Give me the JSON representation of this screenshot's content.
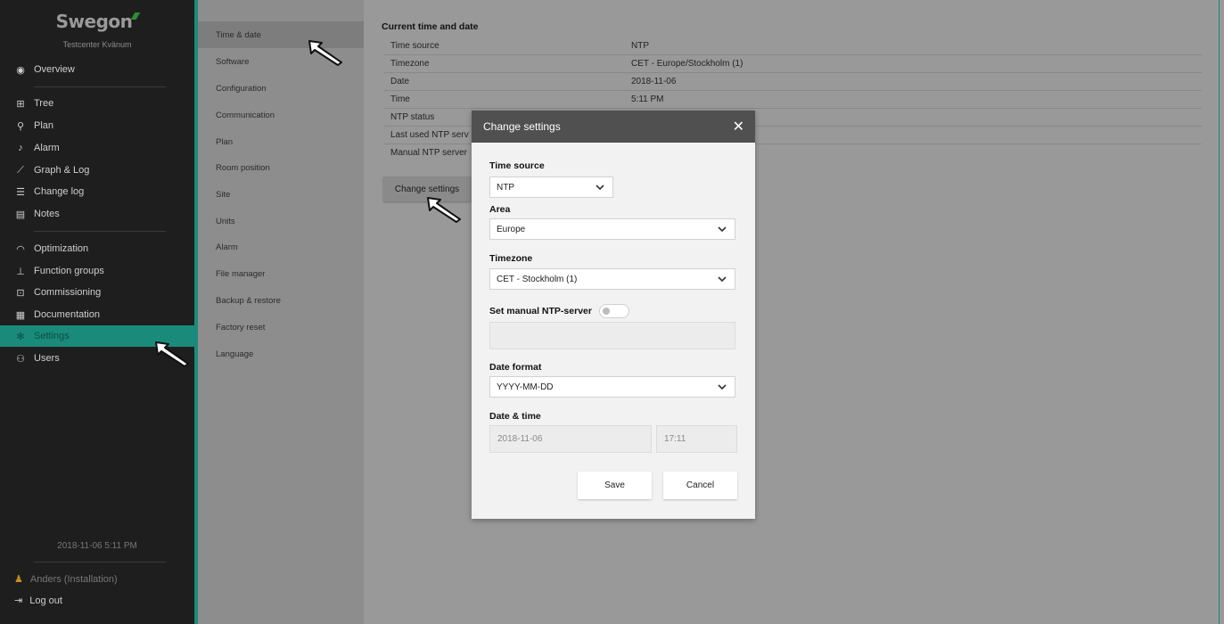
{
  "sidebar": {
    "brand": "Swegon",
    "subtitle": "Testcenter Kvänum",
    "items": [
      {
        "label": "Overview",
        "icon": "eye-icon"
      },
      {
        "label": "Tree",
        "icon": "tree-icon"
      },
      {
        "label": "Plan",
        "icon": "location-pin-icon"
      },
      {
        "label": "Alarm",
        "icon": "bell-icon"
      },
      {
        "label": "Graph & Log",
        "icon": "graph-icon"
      },
      {
        "label": "Change log",
        "icon": "list-icon"
      },
      {
        "label": "Notes",
        "icon": "note-icon"
      },
      {
        "label": "Optimization",
        "icon": "gauge-icon"
      },
      {
        "label": "Function groups",
        "icon": "hierarchy-icon"
      },
      {
        "label": "Commissioning",
        "icon": "commissioning-icon"
      },
      {
        "label": "Documentation",
        "icon": "document-icon"
      },
      {
        "label": "Settings",
        "icon": "gear-icon"
      },
      {
        "label": "Users",
        "icon": "users-icon"
      }
    ],
    "datetime": "2018-11-06 5:11 PM",
    "user": "Anders (Installation)",
    "logout": "Log out"
  },
  "submenu": {
    "items": [
      "Time & date",
      "Software",
      "Configuration",
      "Communication",
      "Plan",
      "Room position",
      "Site",
      "Units",
      "Alarm",
      "File manager",
      "Backup & restore",
      "Factory reset",
      "Language"
    ]
  },
  "main": {
    "section_title": "Current time and date",
    "rows": [
      {
        "key": "Time source",
        "value": "NTP"
      },
      {
        "key": "Timezone",
        "value": "CET - Europe/Stockholm (1)"
      },
      {
        "key": "Date",
        "value": "2018-11-06"
      },
      {
        "key": "Time",
        "value": "5:11 PM"
      },
      {
        "key": "NTP status",
        "value": ""
      },
      {
        "key": "Last used NTP serv",
        "value": ""
      },
      {
        "key": "Manual NTP server",
        "value": ""
      }
    ],
    "change_button": "Change settings"
  },
  "modal": {
    "title": "Change settings",
    "close": "✕",
    "time_source_label": "Time source",
    "time_source_value": "NTP",
    "area_label": "Area",
    "area_value": "Europe",
    "timezone_label": "Timezone",
    "timezone_value": "CET - Stockholm (1)",
    "manual_ntp_label": "Set manual NTP-server",
    "manual_ntp_enabled": false,
    "manual_ntp_value": "",
    "date_format_label": "Date format",
    "date_format_value": "YYYY-MM-DD",
    "datetime_label": "Date & time",
    "date_value": "2018-11-06",
    "time_value": "17:11",
    "save_label": "Save",
    "cancel_label": "Cancel"
  },
  "colors": {
    "accent": "#1a8b7b",
    "sidebar_bg": "#1e1e1e",
    "modal_header": "#505050",
    "overlay": "#999999"
  }
}
